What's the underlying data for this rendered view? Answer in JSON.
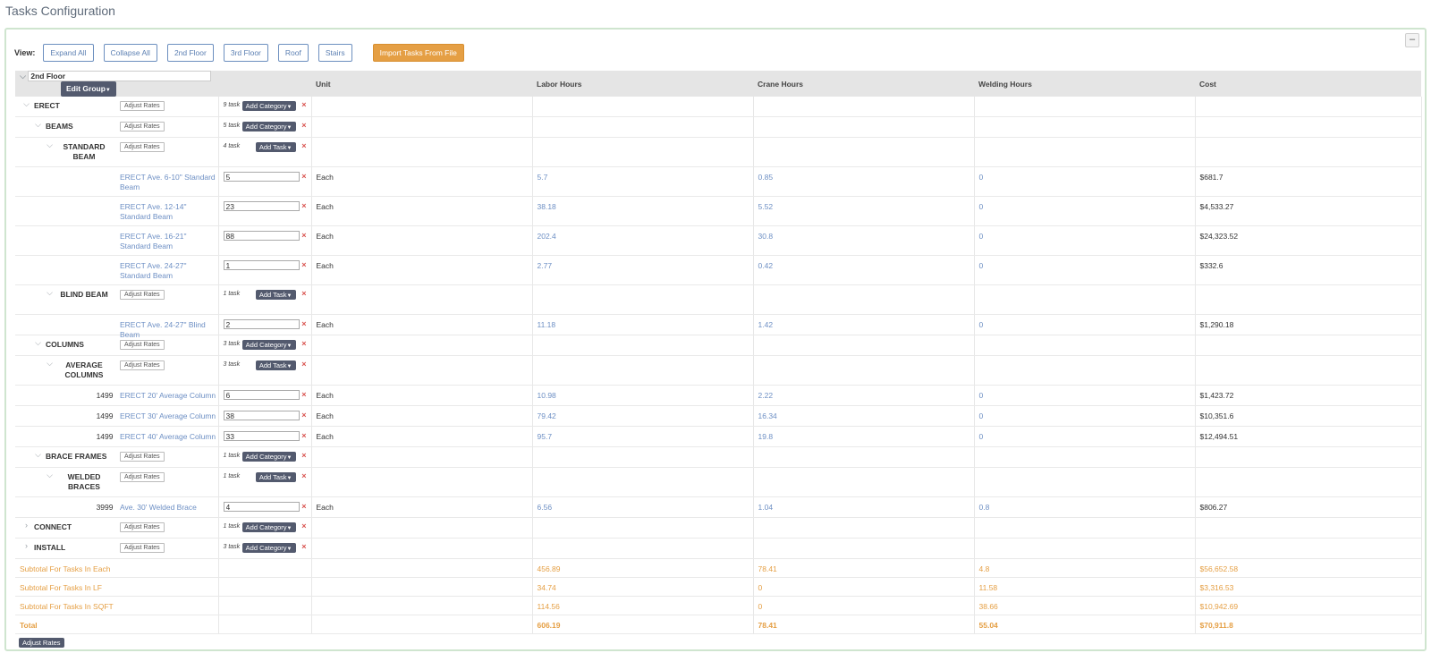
{
  "page_title": "Tasks Configuration",
  "collapse_symbol": "–",
  "view": {
    "label": "View:",
    "buttons": [
      "Expand All",
      "Collapse All",
      "2nd Floor",
      "3rd Floor",
      "Roof",
      "Stairs"
    ],
    "import_label": "Import Tasks From File"
  },
  "header": {
    "group_name": "2nd Floor",
    "edit_group_label": "Edit Group",
    "columns": [
      "Unit",
      "Labor Hours",
      "Crane Hours",
      "Welding Hours",
      "Cost"
    ]
  },
  "labels": {
    "adjust_rates": "Adjust Rates",
    "add_category": "Add Category",
    "add_task": "Add Task",
    "delete": "×",
    "unit_each": "Each"
  },
  "rows": [
    {
      "kind": "cat",
      "level": 0,
      "name": "ERECT",
      "expanded": true,
      "count": "9 task",
      "action": "Add Category"
    },
    {
      "kind": "cat",
      "level": 1,
      "name": "BEAMS",
      "expanded": true,
      "count": "5 task",
      "action": "Add Category"
    },
    {
      "kind": "cat",
      "level": 2,
      "name": "STANDARD BEAM",
      "expanded": true,
      "count": "4 task",
      "action": "Add Task"
    },
    {
      "kind": "task",
      "code": "",
      "name": "ERECT Ave. 6-10\" Standard Beam",
      "qty": "5",
      "unit": "Each",
      "labor": "5.7",
      "crane": "0.85",
      "welding": "0",
      "cost": "$681.7"
    },
    {
      "kind": "task",
      "code": "",
      "name": "ERECT Ave. 12-14\" Standard Beam",
      "qty": "23",
      "unit": "Each",
      "labor": "38.18",
      "crane": "5.52",
      "welding": "0",
      "cost": "$4,533.27"
    },
    {
      "kind": "task",
      "code": "",
      "name": "ERECT Ave. 16-21\" Standard Beam",
      "qty": "88",
      "unit": "Each",
      "labor": "202.4",
      "crane": "30.8",
      "welding": "0",
      "cost": "$24,323.52"
    },
    {
      "kind": "task",
      "code": "",
      "name": "ERECT Ave. 24-27\" Standard Beam",
      "qty": "1",
      "unit": "Each",
      "labor": "2.77",
      "crane": "0.42",
      "welding": "0",
      "cost": "$332.6"
    },
    {
      "kind": "cat",
      "level": 2,
      "name": "BLIND BEAM",
      "expanded": true,
      "count": "1 task",
      "action": "Add Task"
    },
    {
      "kind": "task",
      "code": "",
      "name": "ERECT Ave. 24-27\" Blind Beam",
      "qty": "2",
      "unit": "Each",
      "labor": "11.18",
      "crane": "1.42",
      "welding": "0",
      "cost": "$1,290.18"
    },
    {
      "kind": "cat",
      "level": 1,
      "name": "COLUMNS",
      "expanded": true,
      "count": "3 task",
      "action": "Add Category"
    },
    {
      "kind": "cat",
      "level": 2,
      "name": "AVERAGE COLUMNS",
      "expanded": true,
      "count": "3 task",
      "action": "Add Task"
    },
    {
      "kind": "task",
      "code": "1499",
      "name": "ERECT 20' Average Column",
      "qty": "6",
      "unit": "Each",
      "labor": "10.98",
      "crane": "2.22",
      "welding": "0",
      "cost": "$1,423.72"
    },
    {
      "kind": "task",
      "code": "1499",
      "name": "ERECT 30' Average Column",
      "qty": "38",
      "unit": "Each",
      "labor": "79.42",
      "crane": "16.34",
      "welding": "0",
      "cost": "$10,351.6"
    },
    {
      "kind": "task",
      "code": "1499",
      "name": "ERECT 40' Average Column",
      "qty": "33",
      "unit": "Each",
      "labor": "95.7",
      "crane": "19.8",
      "welding": "0",
      "cost": "$12,494.51"
    },
    {
      "kind": "cat",
      "level": 1,
      "name": "BRACE FRAMES",
      "expanded": true,
      "count": "1 task",
      "action": "Add Category"
    },
    {
      "kind": "cat",
      "level": 2,
      "name": "WELDED BRACES",
      "expanded": true,
      "count": "1 task",
      "action": "Add Task"
    },
    {
      "kind": "task",
      "code": "3999",
      "name": "Ave. 30' Welded Brace",
      "qty": "4",
      "unit": "Each",
      "labor": "6.56",
      "crane": "1.04",
      "welding": "0.8",
      "cost": "$806.27"
    },
    {
      "kind": "cat",
      "level": 0,
      "name": "CONNECT",
      "expanded": false,
      "count": "1 task",
      "action": "Add Category"
    },
    {
      "kind": "cat",
      "level": 0,
      "name": "INSTALL",
      "expanded": false,
      "count": "3 task",
      "action": "Add Category"
    }
  ],
  "subtotals": [
    {
      "label": "Subtotal For Tasks In Each",
      "labor": "456.89",
      "crane": "78.41",
      "welding": "4.8",
      "cost": "$56,652.58"
    },
    {
      "label": "Subtotal For Tasks In LF",
      "labor": "34.74",
      "crane": "0",
      "welding": "11.58",
      "cost": "$3,316.53"
    },
    {
      "label": "Subtotal For Tasks In SQFT",
      "labor": "114.56",
      "crane": "0",
      "welding": "38.66",
      "cost": "$10,942.69"
    }
  ],
  "total": {
    "label": "Total",
    "labor": "606.19",
    "crane": "78.41",
    "welding": "55.04",
    "cost": "$70,911.8"
  },
  "footer_adjust_rates": "Adjust Rates"
}
